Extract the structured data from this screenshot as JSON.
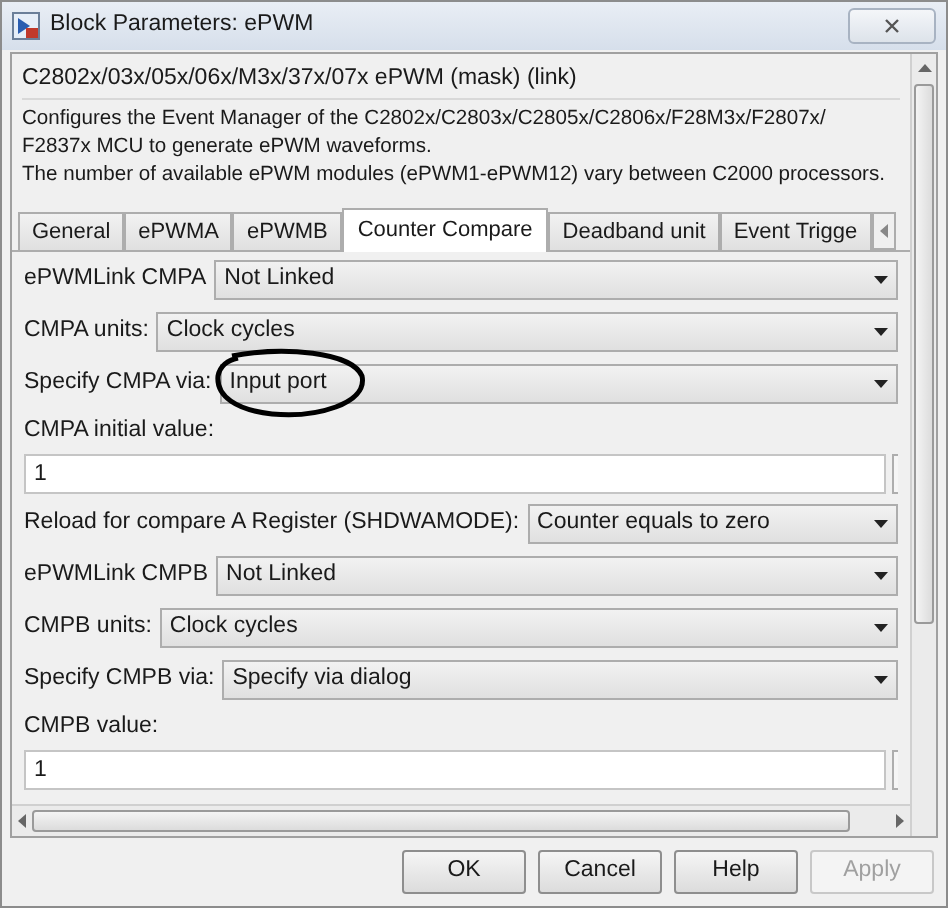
{
  "window": {
    "title": "Block Parameters: ePWM"
  },
  "header": {
    "title": "C2802x/03x/05x/06x/M3x/37x/07x ePWM (mask) (link)",
    "description": [
      "Configures the Event Manager of the C2802x/C2803x/C2805x/C2806x/F28M3x/F2807x/ F2837x MCU to generate ePWM waveforms.",
      "The number of available ePWM modules (ePWM1-ePWM12) vary between C2000 processors."
    ]
  },
  "tabs": [
    {
      "label": "General",
      "selected": false
    },
    {
      "label": "ePWMA",
      "selected": false
    },
    {
      "label": "ePWMB",
      "selected": false
    },
    {
      "label": "Counter Compare",
      "selected": true
    },
    {
      "label": "Deadband unit",
      "selected": false
    },
    {
      "label": "Event Trigge",
      "selected": false
    }
  ],
  "parameters": [
    {
      "kind": "dropdown",
      "label": "ePWMLink CMPA",
      "value": "Not Linked"
    },
    {
      "kind": "dropdown",
      "label": "CMPA units:",
      "value": "Clock cycles"
    },
    {
      "kind": "dropdown",
      "label": "Specify CMPA via:",
      "value": "Input port",
      "circled": true
    },
    {
      "kind": "edit",
      "label": "CMPA initial value:",
      "value": "1"
    },
    {
      "kind": "dropdown",
      "label": "Reload for compare A Register (SHDWAMODE):",
      "value": "Counter equals to zero"
    },
    {
      "kind": "dropdown",
      "label": "ePWMLink CMPB",
      "value": "Not Linked"
    },
    {
      "kind": "dropdown",
      "label": "CMPB units:",
      "value": "Clock cycles"
    },
    {
      "kind": "dropdown",
      "label": "Specify CMPB via:",
      "value": "Specify via dialog"
    },
    {
      "kind": "edit",
      "label": "CMPB value:",
      "value": "1"
    }
  ],
  "buttons": [
    {
      "label": "OK",
      "disabled": false
    },
    {
      "label": "Cancel",
      "disabled": false
    },
    {
      "label": "Help",
      "disabled": false
    },
    {
      "label": "Apply",
      "disabled": true
    }
  ]
}
